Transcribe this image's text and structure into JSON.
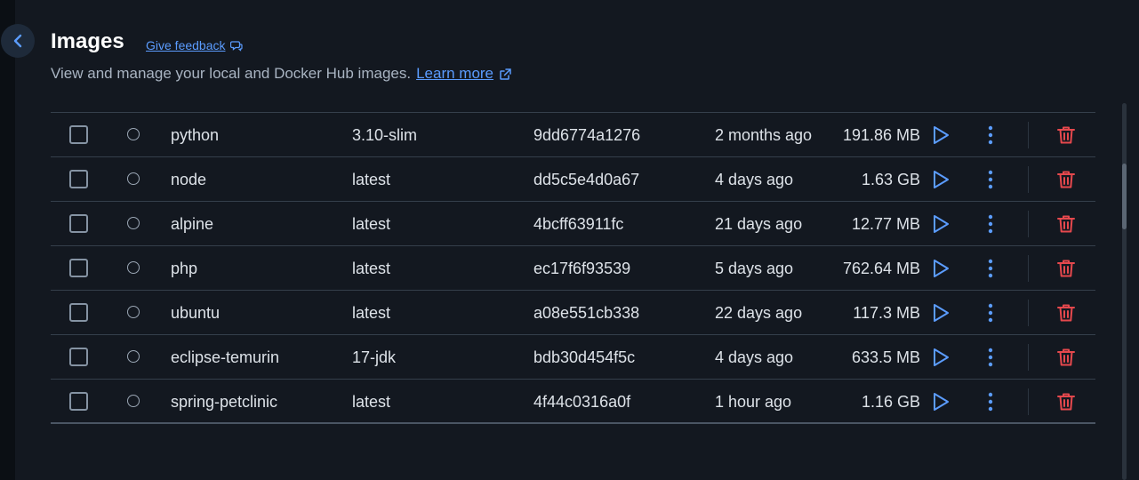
{
  "header": {
    "title": "Images",
    "feedback_label": "Give feedback",
    "subtitle": "View and manage your local and Docker Hub images.",
    "learn_more": "Learn more"
  },
  "colors": {
    "accent": "#5b9cff",
    "delete": "#e5484d",
    "background": "#131820"
  },
  "images": [
    {
      "name": "python",
      "tag": "3.10-slim",
      "id": "9dd6774a1276",
      "created": "2 months ago",
      "size": "191.86 MB"
    },
    {
      "name": "node",
      "tag": "latest",
      "id": "dd5c5e4d0a67",
      "created": "4 days ago",
      "size": "1.63 GB"
    },
    {
      "name": "alpine",
      "tag": "latest",
      "id": "4bcff63911fc",
      "created": "21 days ago",
      "size": "12.77 MB"
    },
    {
      "name": "php",
      "tag": "latest",
      "id": "ec17f6f93539",
      "created": "5 days ago",
      "size": "762.64 MB"
    },
    {
      "name": "ubuntu",
      "tag": "latest",
      "id": "a08e551cb338",
      "created": "22 days ago",
      "size": "117.3 MB"
    },
    {
      "name": "eclipse-temurin",
      "tag": "17-jdk",
      "id": "bdb30d454f5c",
      "created": "4 days ago",
      "size": "633.5 MB"
    },
    {
      "name": "spring-petclinic",
      "tag": "latest",
      "id": "4f44c0316a0f",
      "created": "1 hour ago",
      "size": "1.16 GB"
    }
  ]
}
